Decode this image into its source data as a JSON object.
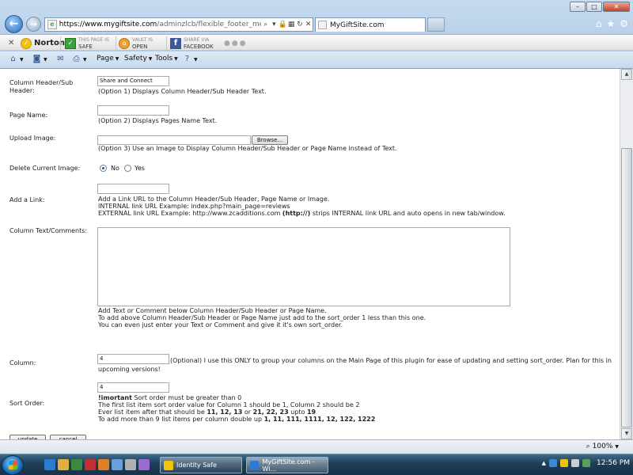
{
  "window": {
    "min_label": "–",
    "max_label": "□",
    "close_label": "✕"
  },
  "browser": {
    "url_domain": "https://www.mygiftsite.com",
    "url_path": "/adminzlcb/flexible_footer_menu.php?p",
    "tab_title": "MyGiftSite.com"
  },
  "norton_bar": {
    "logo_text": "Norton",
    "safe_top": "THIS PAGE IS",
    "safe_bottom": "SAFE",
    "vault_top": "VAULT IS",
    "vault_bottom": "OPEN",
    "share_top": "SHARE VIA",
    "share_bottom": "FACEBOOK"
  },
  "command_bar": {
    "page": "Page",
    "safety": "Safety",
    "tools": "Tools"
  },
  "form": {
    "header_label": "Column Header/Sub Header:",
    "header_value": "Share and Connect",
    "header_desc": "(Option 1) Displays Column Header/Sub Header Text.",
    "page_name_label": "Page Name:",
    "page_name_desc": "(Option 2) Displays Pages Name Text.",
    "upload_label": "Upload Image:",
    "browse_label": "Browse...",
    "upload_desc": "(Option 3) Use an Image to Display Column Header/Sub Header or Page Name instead of Text.",
    "delete_label": "Delete Current Image:",
    "no_label": "No",
    "yes_label": "Yes",
    "link_label": "Add a Link:",
    "link_desc_1": "Add a Link URL to the Column Header/Sub Header, Page Name or Image.",
    "link_desc_2": "INTERNAL link URL Example: index.php?main_page=reviews",
    "link_desc_3a": "EXTERNAL link URL Example: http://www.zcadditions.com",
    "link_desc_3b": "(http://)",
    "link_desc_3c": "strips INTERNAL link URL and auto opens in new tab/window.",
    "text_label": "Column Text/Comments:",
    "text_desc_1": "Add Text or Comment below Column Header/Sub Header or Page Name.",
    "text_desc_2": "To add above Column Header/Sub Header or Page Name just add to the sort_order 1 less than this one.",
    "text_desc_3": "You can even just enter your Text or Comment and give it it's own sort_order.",
    "column_label": "Column:",
    "column_value": "4",
    "column_desc_1": "(Optional) I use this ONLY to group your columns on the Main Page of this plugin for ease of updating and setting sort_order. Plan for this in",
    "column_desc_2": "upcoming versions!",
    "sort_label": "Sort Order:",
    "sort_value": "4",
    "sort_important": "!imortant",
    "sort_desc_1": "Sort order must be greater than 0",
    "sort_desc_2": "The first list item sort order value for Column 1 should be 1, Column 2 should be 2",
    "sort_desc_3a": "Ever list item after that should be",
    "sort_desc_3b": "11, 12, 13",
    "sort_desc_3c": "or",
    "sort_desc_3d": "21, 22, 23",
    "sort_desc_3e": "upto",
    "sort_desc_3f": "19",
    "sort_desc_4a": "To add more than 9 list items per column double up",
    "sort_desc_4b": "1, 11, 111, 1111, 12, 122, 1222",
    "update_label": "update",
    "cancel_label": "cancel"
  },
  "status": {
    "zoom": "100%"
  },
  "taskbar": {
    "task_1": "Identity Safe",
    "task_2": "MyGiftSite.com - Wi...",
    "time": "12:56 PM"
  }
}
